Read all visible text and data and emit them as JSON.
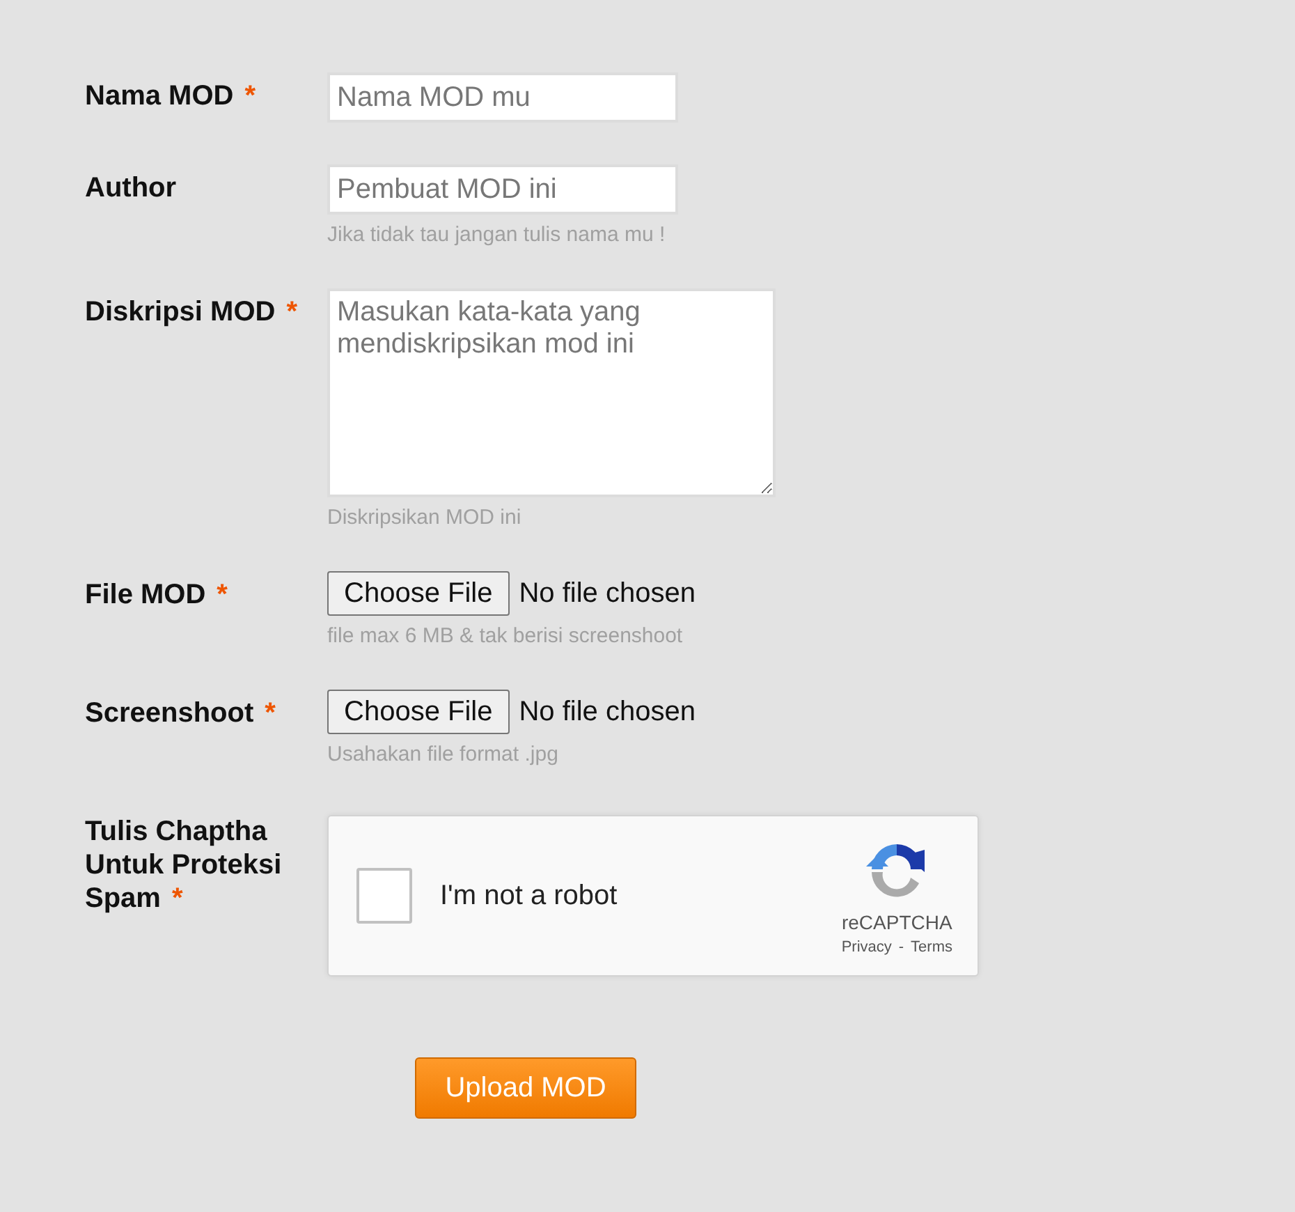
{
  "fields": [
    {
      "kind": "text",
      "label": "Nama MOD",
      "required": true,
      "placeholder": "Nama MOD mu"
    },
    {
      "kind": "text",
      "label": "Author",
      "required": false,
      "placeholder": "Pembuat MOD ini",
      "hint": "Jika tidak tau jangan tulis nama mu !"
    },
    {
      "kind": "textarea",
      "label": "Diskripsi MOD",
      "required": true,
      "placeholder": "Masukan kata-kata yang mendiskripsikan mod ini",
      "hint": "Diskripsikan MOD ini"
    },
    {
      "kind": "file",
      "label": "File MOD",
      "required": true,
      "button": "Choose File",
      "status": "No file chosen",
      "hint": "file max 6 MB & tak berisi screenshoot"
    },
    {
      "kind": "file",
      "label": "Screenshoot",
      "required": true,
      "button": "Choose File",
      "status": "No file chosen",
      "hint": "Usahakan file format .jpg"
    },
    {
      "kind": "captcha",
      "label": "Tulis Chaptha Untuk Proteksi Spam",
      "required": true,
      "checked": false,
      "text": "I'm not a robot",
      "brand": "reCAPTCHA",
      "privacy": "Privacy",
      "separator": "-",
      "terms": "Terms"
    }
  ],
  "required_mark": "*",
  "submit": "Upload MOD"
}
